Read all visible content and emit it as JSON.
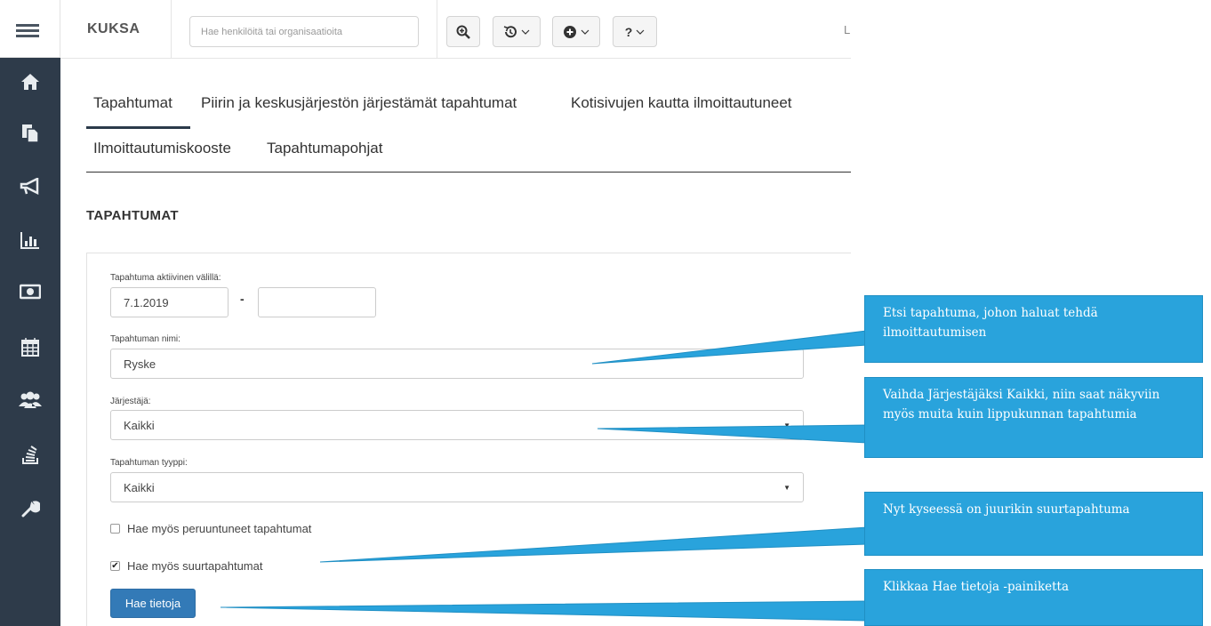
{
  "app": {
    "brand": "KUKSA",
    "search_placeholder": "Hae henkilöitä tai organisaatioita",
    "top_cut_text": "L"
  },
  "sidebar": {
    "items": [
      {
        "icon": "home-icon"
      },
      {
        "icon": "documents-icon"
      },
      {
        "icon": "megaphone-icon"
      },
      {
        "icon": "bar-chart-icon"
      },
      {
        "icon": "money-icon"
      },
      {
        "icon": "calendar-icon"
      },
      {
        "icon": "users-icon"
      },
      {
        "icon": "stack-icon"
      },
      {
        "icon": "wrench-icon"
      }
    ]
  },
  "toolbar": {
    "zoom_icon": "zoom-in-icon",
    "history_icon": "history-icon",
    "add_icon": "plus-circle-icon",
    "help_label": "?"
  },
  "tabs": [
    {
      "label": "Tapahtumat",
      "active": true
    },
    {
      "label": "Piirin ja keskusjärjestön järjestämät tapahtumat"
    },
    {
      "label": "Kotisivujen kautta ilmoittautuneet"
    },
    {
      "label": "Ilmoittautumiskooste"
    },
    {
      "label": "Tapahtumapohjat"
    }
  ],
  "section_title": "TAPAHTUMAT",
  "form": {
    "date_range_label": "Tapahtuma aktiivinen välillä:",
    "date_start": "7.1.2019",
    "date_separator": "-",
    "date_end": "",
    "name_label": "Tapahtuman nimi:",
    "name_value": "Ryske",
    "organizer_label": "Järjestäjä:",
    "organizer_value": "Kaikki",
    "type_label": "Tapahtuman tyyppi:",
    "type_value": "Kaikki",
    "cancelled_label": "Hae myös peruuntuneet tapahtumat",
    "cancelled_checked": false,
    "large_events_label": "Hae myös suurtapahtumat",
    "large_events_checked": true,
    "submit_label": "Hae tietoja"
  },
  "callouts": [
    {
      "text": "Etsi tapahtuma, johon haluat tehdä ilmoittautumisen"
    },
    {
      "text": "Vaihda Järjestäjäksi Kaikki, niin saat näkyviin myös muita kuin lippukunnan tapahtumia"
    },
    {
      "text": "Nyt kyseessä on juurikin suurtapahtuma"
    },
    {
      "text": "Klikkaa Hae tietoja -painiketta"
    }
  ],
  "colors": {
    "sidebar": "#2e3b4a",
    "primary": "#337ab7",
    "callout": "#29a3dc"
  }
}
